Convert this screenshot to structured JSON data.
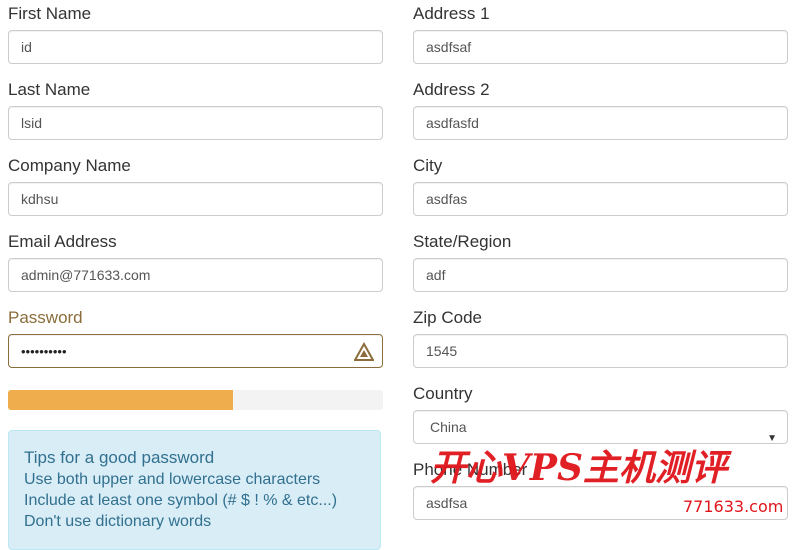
{
  "left": {
    "first_name": {
      "label": "First Name",
      "value": "id"
    },
    "last_name": {
      "label": "Last Name",
      "value": "lsid"
    },
    "company": {
      "label": "Company Name",
      "value": "kdhsu"
    },
    "email": {
      "label": "Email Address",
      "value": "admin@771633.com"
    },
    "password": {
      "label": "Password",
      "value": "••••••••••",
      "status_icon": "warning-icon"
    },
    "strength": {
      "percent": 60,
      "color": "#f0ad4e"
    },
    "tips": {
      "title": "Tips for a good password",
      "lines": [
        "Use both upper and lowercase characters",
        "Include at least one symbol (# $ ! % & etc...)",
        "Don't use dictionary words"
      ]
    }
  },
  "right": {
    "address1": {
      "label": "Address 1",
      "value": "asdfsaf"
    },
    "address2": {
      "label": "Address 2",
      "value": "asdfasfd"
    },
    "city": {
      "label": "City",
      "value": "asdfas"
    },
    "state": {
      "label": "State/Region",
      "value": "adf"
    },
    "zip": {
      "label": "Zip Code",
      "value": "1545"
    },
    "country": {
      "label": "Country",
      "value": "China"
    },
    "phone": {
      "label": "Phone Number",
      "value": "asdfsa"
    }
  },
  "watermark": {
    "text": "开心VPS主机测评",
    "url": "771633.com",
    "color": "#e0151b"
  }
}
